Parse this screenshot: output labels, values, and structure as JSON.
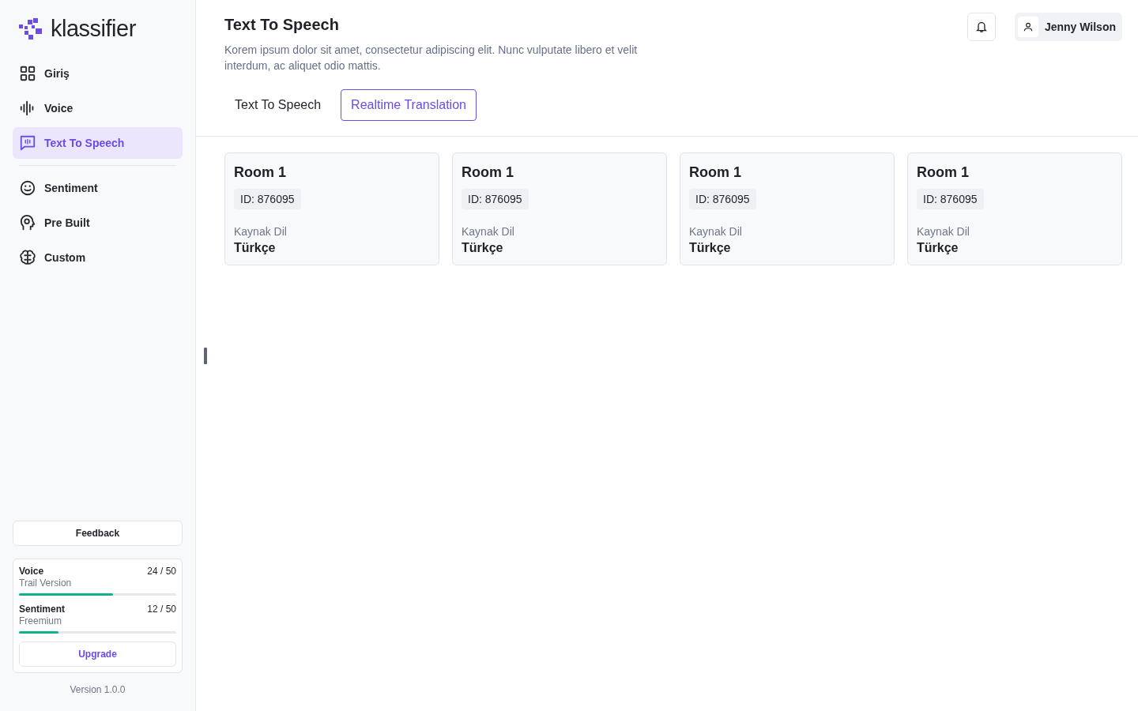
{
  "sidebar": {
    "logo": "klassifier",
    "nav_groups": [
      [
        {
          "label": "Giriş",
          "kind": "grid",
          "selected": false
        },
        {
          "label": "Voice",
          "kind": "wave",
          "selected": false
        },
        {
          "label": "Text To Speech",
          "kind": "speech",
          "selected": true
        }
      ],
      [
        {
          "label": "Sentiment",
          "kind": "smile",
          "selected": false
        },
        {
          "label": "Pre Built",
          "kind": "head",
          "selected": false
        },
        {
          "label": "Custom",
          "kind": "brain",
          "selected": false
        }
      ]
    ],
    "feedback_button": "Feedback",
    "usage": [
      {
        "name": "Voice",
        "plan": "Trail Version",
        "count": "24 / 50",
        "level": 0.6
      },
      {
        "name": "Sentiment",
        "plan": "Freemium",
        "count": "12 / 50",
        "level": 0.25
      }
    ],
    "upgrade_button": "Upgrade",
    "version": "Version 1.0.0"
  },
  "header": {
    "title": "Text To Speech",
    "description": "Korem ipsum dolor sit amet, consectetur adipiscing elit. Nunc vulputate libero et velit interdum, ac aliquet odio mattis.",
    "user_name": "Jenny Wilson"
  },
  "tabs": [
    {
      "label": "Text To Speech",
      "selected": false
    },
    {
      "label": "Realtime Translation",
      "selected": true
    }
  ],
  "rooms": [
    {
      "name": "Room 1",
      "id": "ID: 876095",
      "field_label": "Kaynak Dil",
      "field_value": "Türkçe"
    },
    {
      "name": "Room 1",
      "id": "ID: 876095",
      "field_label": "Kaynak Dil",
      "field_value": "Türkçe"
    },
    {
      "name": "Room 1",
      "id": "ID: 876095",
      "field_label": "Kaynak Dil",
      "field_value": "Türkçe"
    },
    {
      "name": "Room 1",
      "id": "ID: 876095",
      "field_label": "Kaynak Dil",
      "field_value": "Türkçe"
    }
  ]
}
